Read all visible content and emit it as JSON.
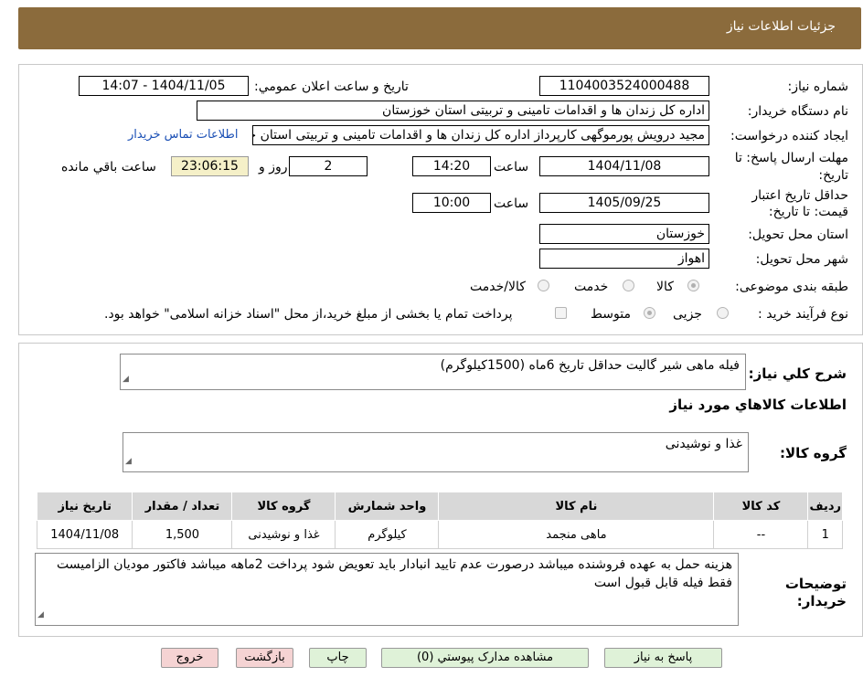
{
  "header": {
    "title": "جزئیات اطلاعات نیاز"
  },
  "form": {
    "need_number_label": "شماره نیاز:",
    "need_number": "1104003524000488",
    "announce_label": "تاریخ و ساعت اعلان عمومي:",
    "announce_value": "1404/11/05 - 14:07",
    "buyer_org_label": "نام دستگاه خریدار:",
    "buyer_org": "اداره کل زندان ها و اقدامات تامینی و تربیتی استان خوزستان",
    "requester_label": "ایجاد کننده درخواست:",
    "requester": "مجید درویش پورموگهی کارپرداز اداره کل زندان ها و اقدامات تامینی و تربیتی استان خوزستان",
    "contact_link": "اطلاعات تماس خریدار",
    "deadline_label_1": "مهلت ارسال پاسخ: تا",
    "deadline_label_2": "تاریخ:",
    "deadline_date": "1404/11/08",
    "time_label": "ساعت",
    "deadline_time": "14:20",
    "days_value": "2",
    "days_label": "روز و",
    "remaining_time": "23:06:15",
    "remaining_label": "ساعت باقي مانده",
    "validity_label_1": "حداقل تاریخ اعتبار",
    "validity_label_2": "قیمت: تا تاریخ:",
    "validity_date": "1405/09/25",
    "validity_time_label": "ساعت",
    "validity_time": "10:00",
    "province_label": "استان محل تحویل:",
    "province": "خوزستان",
    "city_label": "شهر محل تحویل:",
    "city": "اهواز",
    "category_label": "طبقه بندی موضوعی:",
    "category_options": [
      "کالا",
      "خدمت",
      "کالا/خدمت"
    ],
    "process_label": "نوع فرآیند خرید :",
    "process_options": [
      "جزیی",
      "متوسط"
    ],
    "payment_note": "پرداخت تمام یا بخشی از مبلغ خرید،از محل \"اسناد خزانه اسلامی\" خواهد بود."
  },
  "summary": {
    "desc_label": "شرح کلي نياز:",
    "desc_value": "فیله ماهی شیر گالیت حداقل تاریخ 6ماه (1500کیلوگرم)",
    "goods_title": "اطلاعات کالاهاي مورد نياز",
    "group_label": "گروه کالا:",
    "group_value": "غذا و نوشیدنی",
    "table": {
      "headers": [
        "رديف",
        "کد کالا",
        "نام کالا",
        "واحد شمارش",
        "گروه کالا",
        "تعداد / مقدار",
        "تاریخ نیاز"
      ],
      "rows": [
        [
          "1",
          "--",
          "ماهی منجمد",
          "کیلوگرم",
          "غذا و نوشیدنی",
          "1,500",
          "1404/11/08"
        ]
      ]
    },
    "notes_label_1": "توضیحات",
    "notes_label_2": "خریدار:",
    "notes_value": "هزینه حمل به عهده فروشنده میباشد درصورت عدم تایید انبادار باید تعویض شود پرداخت 2ماهه میباشد فاکتور مودیان الزامیست فقط فیله قابل قبول است"
  },
  "buttons": {
    "reply": "پاسخ به نياز",
    "attachments": "مشاهده مدارک پيوستي (0)",
    "print": "چاپ",
    "back": "بازگشت",
    "exit": "خروج"
  },
  "colors": {
    "header_bg": "#8b6b3c",
    "remaining_bg": "#f5f0c8",
    "green_btn": "#dff2d8",
    "red_btn": "#f5d3d3",
    "link": "#1a4fb5"
  }
}
